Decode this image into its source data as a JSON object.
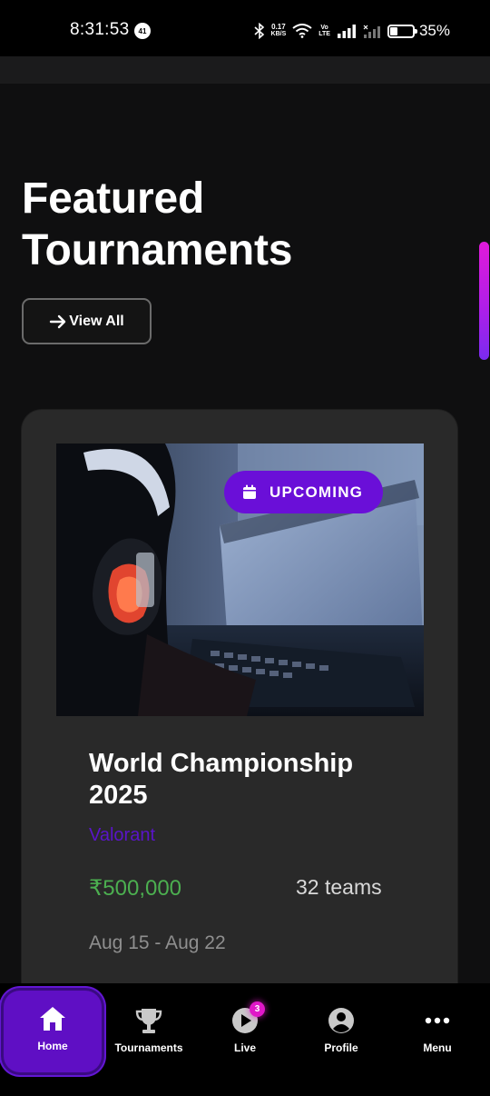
{
  "status_bar": {
    "time": "8:31:53",
    "notification_count": "41",
    "net_speed_value": "0.17",
    "net_speed_unit": "KB/S",
    "volte_top": "Vo",
    "volte_bottom": "LTE",
    "battery": "35%",
    "battery_level": 0.35
  },
  "header": {
    "title": "Featured Tournaments",
    "view_all_label": "View All"
  },
  "tournament": {
    "status": "UPCOMING",
    "title": "World Championship 2025",
    "game": "Valorant",
    "prize": "₹500,000",
    "teams": "32 teams",
    "dates": "Aug 15 - Aug 22",
    "image_subject": "gamer-with-headset-at-computer"
  },
  "bottom_nav": {
    "items": [
      {
        "label": "Home",
        "icon": "home-icon",
        "active": true
      },
      {
        "label": "Tournaments",
        "icon": "trophy-icon",
        "active": false
      },
      {
        "label": "Live",
        "icon": "play-icon",
        "active": false,
        "badge": "3"
      },
      {
        "label": "Profile",
        "icon": "profile-icon",
        "active": false
      },
      {
        "label": "Menu",
        "icon": "more-icon",
        "active": false
      }
    ]
  },
  "colors": {
    "accent": "#6a0fd8",
    "active_nav": "#5f0fc4",
    "prize_green": "#4caf50",
    "game_purple": "#5a14c9",
    "live_badge": "#e018c8"
  }
}
